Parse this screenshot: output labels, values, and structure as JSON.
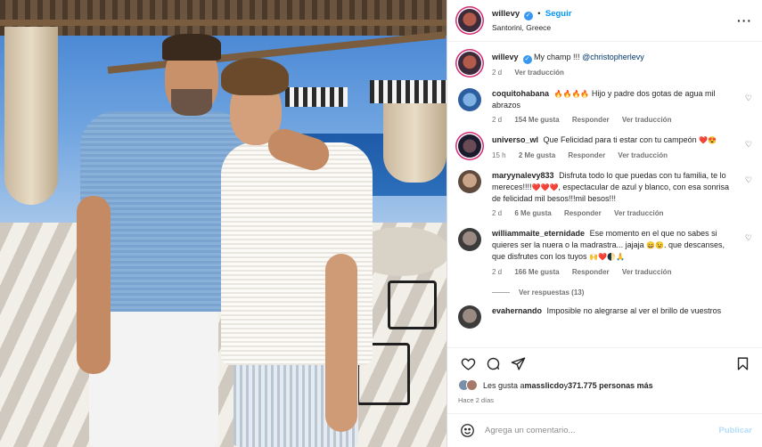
{
  "post": {
    "username": "willevy",
    "follow_label": "Seguir",
    "location": "Santorini, Greece",
    "caption_user": "willevy",
    "caption_text": "My champ !!! ",
    "caption_mention": "@christopherlevy",
    "caption_age": "2 d",
    "caption_translate": "Ver traducción"
  },
  "comments": [
    {
      "user": "coquitohabana",
      "emoji": "🔥🔥🔥🔥",
      "text": " Hijo y padre dos gotas de agua mil abrazos",
      "age": "2 d",
      "likes": "154 Me gusta",
      "reply": "Responder",
      "translate": "Ver traducción"
    },
    {
      "user": "universo_wl",
      "text": "Que Felicidad para ti estar con tu campeón ",
      "emoji": "❤️😍",
      "age": "15 h",
      "likes": "2 Me gusta",
      "reply": "Responder",
      "translate": "Ver traducción"
    },
    {
      "user": "maryynalevy833",
      "text": "Disfruta todo lo que puedas con tu familia, te lo mereces!!!!",
      "emoji": "❤️❤️❤️",
      "text2": ", espectacular de azul y blanco, con esa sonrisa de felicidad mil besos!!!mil besos!!!",
      "age": "2 d",
      "likes": "6 Me gusta",
      "reply": "Responder",
      "translate": "Ver traducción"
    },
    {
      "user": "williammaite_eternidade",
      "text": "Ese momento en el que no sabes si quieres ser la nuera o la madrastra... jajaja ",
      "emoji": "😄😉",
      "text2": ". que descanses, que disfrutes con los tuyos ",
      "emoji2": "🙌❤️🌓🙏",
      "age": "2 d",
      "likes": "166 Me gusta",
      "reply": "Responder",
      "translate": "Ver traducción"
    },
    {
      "user": "evahernando",
      "text": "Imposible no alegrarse al ver el brillo de vuestros"
    }
  ],
  "replies_label": "Ver respuestas (13)",
  "likes_summary": {
    "prefix": "Les gusta a ",
    "user": "masslicdo",
    "middle": " y ",
    "count": "371.775 personas más"
  },
  "posted_when": "Hace 2 días",
  "composer": {
    "placeholder": "Agrega un comentario...",
    "post_label": "Publicar"
  },
  "colors": {
    "link_blue": "#0095f6",
    "post_disabled": "#b2dffc",
    "secondary_text": "#737373"
  },
  "icons": {
    "like": "heart-outline-icon",
    "comment": "comment-bubble-icon",
    "share": "paper-plane-icon",
    "save": "bookmark-icon",
    "emoji": "smiley-icon",
    "options": "ellipsis-icon"
  }
}
